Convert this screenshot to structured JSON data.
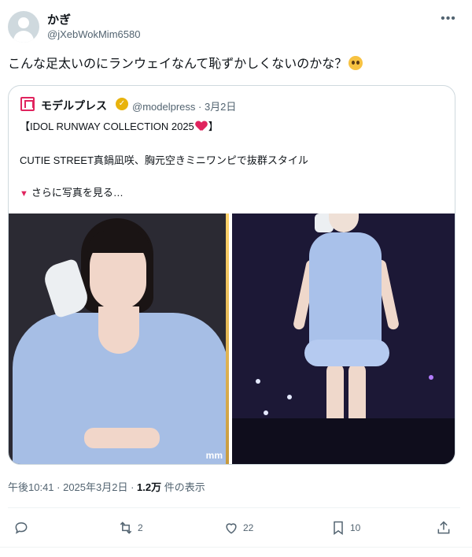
{
  "author": {
    "display_name": "かぎ",
    "handle": "@jXebWokMim6580"
  },
  "tweet_text": "こんな足太いのにランウェイなんて恥ずかしくないのかな？",
  "quote": {
    "name": "モデルプレス",
    "meta": "@modelpress · 3月2日",
    "line1_prefix": "【IDOL RUNWAY COLLECTION 2025",
    "line1_suffix": "】",
    "line2": "CUTIE STREET真鍋凪咲、胸元空きミニワンピで抜群スタイル",
    "line3": "さらに写真を見る…",
    "watermark": "mm"
  },
  "timestamp": {
    "time_date": "午後10:41 · 2025年3月2日 · ",
    "views": "1.2万",
    "views_suffix": " 件の表示"
  },
  "actions": {
    "reply_count": "",
    "retweet_count": "2",
    "like_count": "22",
    "bookmark_count": "10"
  },
  "colors": {
    "accent": "#e0245e",
    "muted": "#536471",
    "verified": "#e8b30d"
  }
}
